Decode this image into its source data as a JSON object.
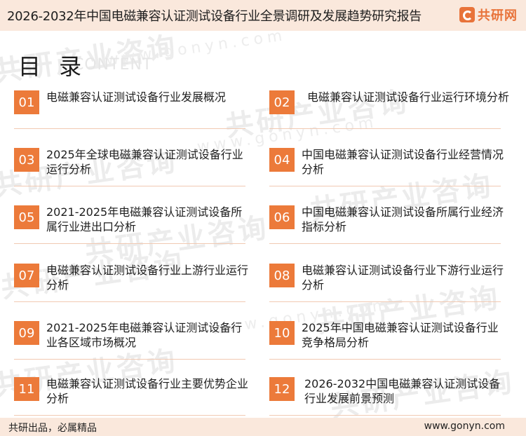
{
  "header": {
    "title": "2026-2032年中国电磁兼容认证测试设备行业全景调研及发展趋势研究报告",
    "brand": "共研网",
    "brand_color": "#e8733a"
  },
  "toc": {
    "heading": "目 录",
    "heading_en": "CONTENT",
    "items": [
      {
        "num": "01",
        "text": "电磁兼容认证测试设备行业发展概况"
      },
      {
        "num": "02",
        "text": "电磁兼容认证测试设备行业运行环境分析"
      },
      {
        "num": "03",
        "text": "2025年全球电磁兼容认证测试设备行业运行分析"
      },
      {
        "num": "04",
        "text": "中国电磁兼容认证测试设备行业经营情况分析"
      },
      {
        "num": "05",
        "text": "2021-2025年电磁兼容认证测试设备所属行业进出口分析"
      },
      {
        "num": "06",
        "text": "中国电磁兼容认证测试设备所属行业经济指标分析"
      },
      {
        "num": "07",
        "text": "电磁兼容认证测试设备行业上游行业运行分析"
      },
      {
        "num": "08",
        "text": "电磁兼容认证测试设备行业下游行业运行分析"
      },
      {
        "num": "09",
        "text": "2021-2025年电磁兼容认证测试设备行业各区域市场概况"
      },
      {
        "num": "10",
        "text": "2025年中国电磁兼容认证测试设备行业竞争格局分析"
      },
      {
        "num": "11",
        "text": "电磁兼容认证测试设备行业主要优势企业分析"
      },
      {
        "num": "12",
        "text": "2026-2032中国电磁兼容认证测试设备行业发展前景预测"
      }
    ],
    "accent_color": "#ec7a3a"
  },
  "watermark": {
    "text": "共研产业咨询",
    "url": "www.gonyn.com"
  },
  "footer": {
    "slogan": "共研出品，必属精品",
    "url": "www.gonyn.com"
  }
}
